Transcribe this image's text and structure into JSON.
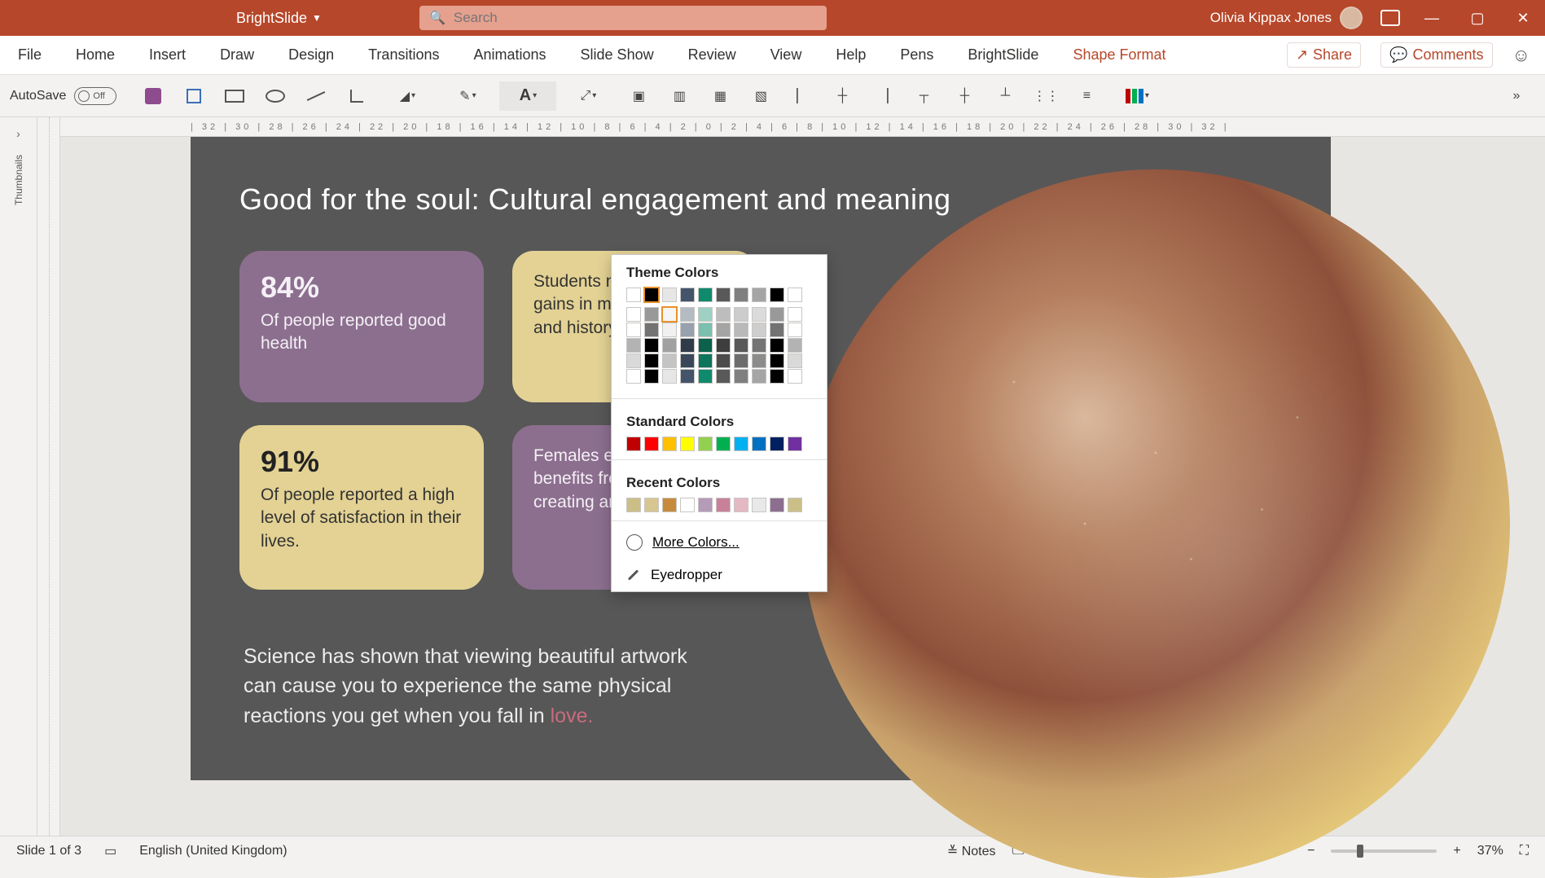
{
  "titlebar": {
    "brand": "BrightSlide",
    "search_placeholder": "Search",
    "user_name": "Olivia Kippax Jones"
  },
  "ribbon": {
    "tabs": [
      "File",
      "Home",
      "Insert",
      "Draw",
      "Design",
      "Transitions",
      "Animations",
      "Slide Show",
      "Review",
      "View",
      "Help",
      "Pens",
      "BrightSlide",
      "Shape Format"
    ],
    "active_tab": "Shape Format",
    "share": "Share",
    "comments": "Comments"
  },
  "toolbar": {
    "autosave_label": "AutoSave",
    "autosave_state": "Off"
  },
  "color_picker": {
    "theme_label": "Theme Colors",
    "theme_row": [
      "#ffffff",
      "#000000",
      "#e7e6e6",
      "#44546a",
      "#0f8a6c",
      "#595959",
      "#7f7f7f",
      "#a5a5a5",
      "#000000",
      "#ffffff"
    ],
    "selected_index": 1,
    "tint_highlight_index": 2,
    "standard_label": "Standard Colors",
    "standard_row": [
      "#c00000",
      "#ff0000",
      "#ffc000",
      "#ffff00",
      "#92d050",
      "#00b050",
      "#00b0f0",
      "#0070c0",
      "#002060",
      "#7030a0"
    ],
    "recent_label": "Recent Colors",
    "recent_row": [
      "#cbbf87",
      "#d8c690",
      "#c78a3d",
      "#ffffff",
      "#b49bb8",
      "#c9819a",
      "#e5b9c4",
      "#e8e8e8",
      "#8c6f8f",
      "#cbbf87"
    ],
    "more_colors": "More Colors...",
    "eyedropper": "Eyedropper"
  },
  "slide": {
    "title": "Good for the soul: Cultural engagement and meaning",
    "card1_stat": "84%",
    "card1_text": "Of people reported good health",
    "card2_text": "Students made significant gains in math, reading, and history",
    "card3_stat": "91%",
    "card3_text": "Of people reported a high level of satisfaction in their lives.",
    "card4_text": "Females experienced benefits from actively creating art",
    "footnote_a": "Science has shown that viewing beautiful artwork can cause you to experience the same physical reactions you get when you fall in ",
    "footnote_love": "love."
  },
  "status": {
    "slide_counter": "Slide 1 of 3",
    "language": "English (United Kingdom)",
    "notes": "Notes",
    "display_settings": "Display Settings",
    "zoom": "37%"
  }
}
